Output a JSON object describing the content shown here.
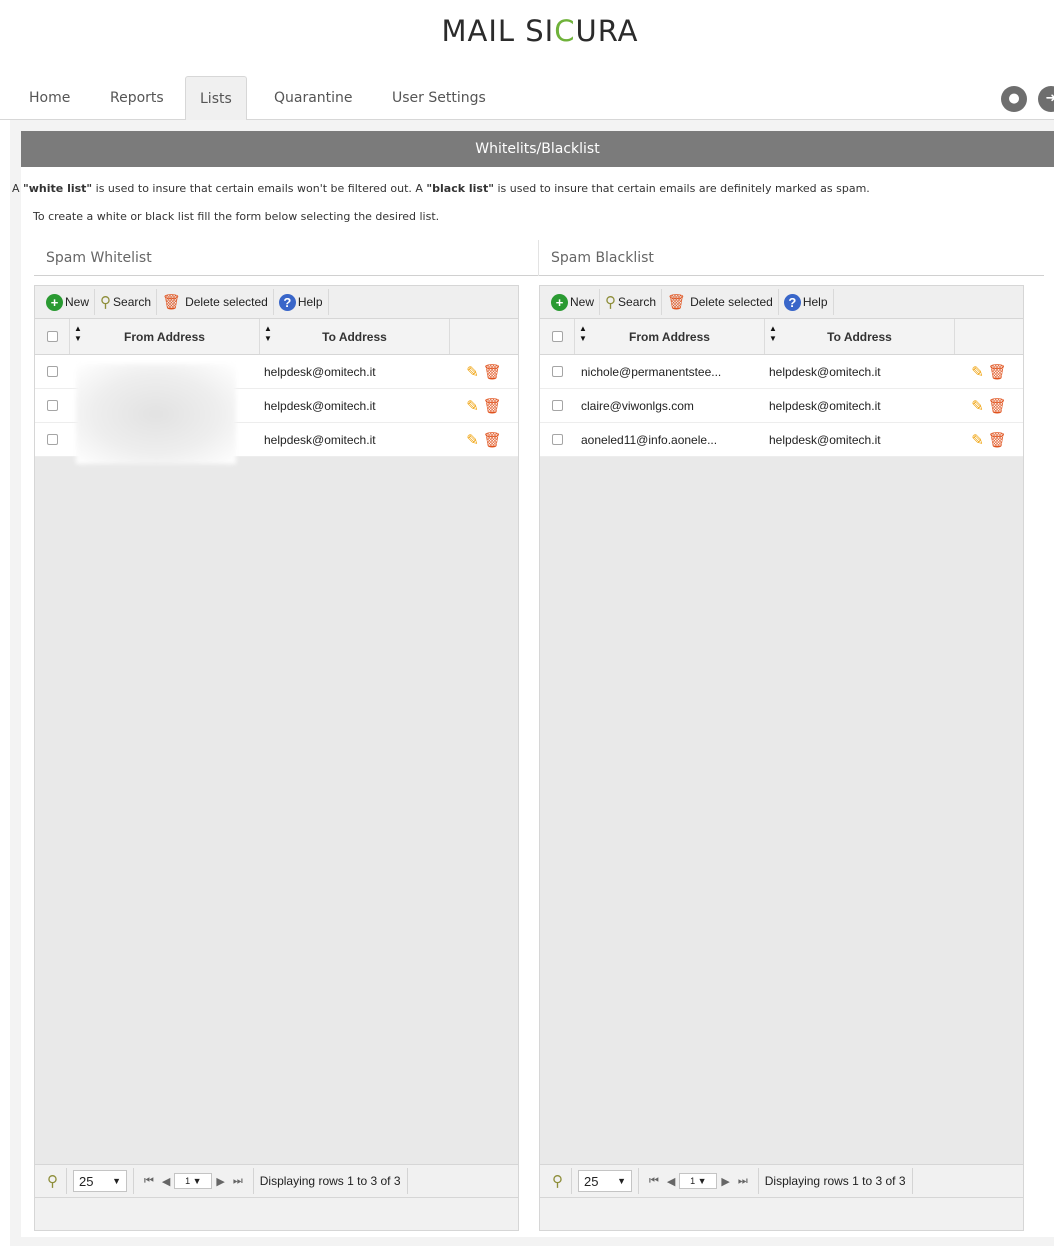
{
  "brand": {
    "part1": "MAIL SI",
    "accent": "C",
    "part2": "URA"
  },
  "tabs": [
    {
      "label": "Home"
    },
    {
      "label": "Reports"
    },
    {
      "label": "Lists"
    },
    {
      "label": "Quarantine"
    },
    {
      "label": "User Settings"
    }
  ],
  "active_tab": "Lists",
  "icons": {
    "user": "user-icon",
    "logout": "logout-icon"
  },
  "panel": {
    "title": "Whitelits/Blacklist",
    "desc1_a": "A ",
    "desc1_b": "\"white list\"",
    "desc1_c": " is used to insure that certain emails won't be filtered out. A ",
    "desc1_d": "\"black list\"",
    "desc1_e": " is used to insure that certain emails are definitely marked as spam.",
    "desc2": "To create a white or black list fill the form below selecting the desired list."
  },
  "toolbar": {
    "new": "New",
    "search": "Search",
    "delete": "Delete selected",
    "help": "Help"
  },
  "columns": {
    "from": "From Address",
    "to": "To Address"
  },
  "whitelist": {
    "title": "Spam Whitelist",
    "rows": [
      {
        "from": "",
        "to": "helpdesk@omitech.it"
      },
      {
        "from": "",
        "to": "helpdesk@omitech.it"
      },
      {
        "from": "",
        "to": "helpdesk@omitech.it"
      }
    ]
  },
  "blacklist": {
    "title": "Spam Blacklist",
    "rows": [
      {
        "from": "nichole@permanentstee...",
        "to": "helpdesk@omitech.it"
      },
      {
        "from": "claire@viwonlgs.com",
        "to": "helpdesk@omitech.it"
      },
      {
        "from": "aoneled11@info.aonele...",
        "to": "helpdesk@omitech.it"
      }
    ]
  },
  "pager": {
    "page_size": "25",
    "page": "1",
    "status": "Displaying rows 1 to 3 of 3"
  },
  "colors": {
    "accent": "#6fb23a",
    "header": "#7b7b7b",
    "new": "#2a9a32",
    "delete": "#e0521d",
    "help": "#3966c9",
    "edit": "#f0a20b"
  }
}
